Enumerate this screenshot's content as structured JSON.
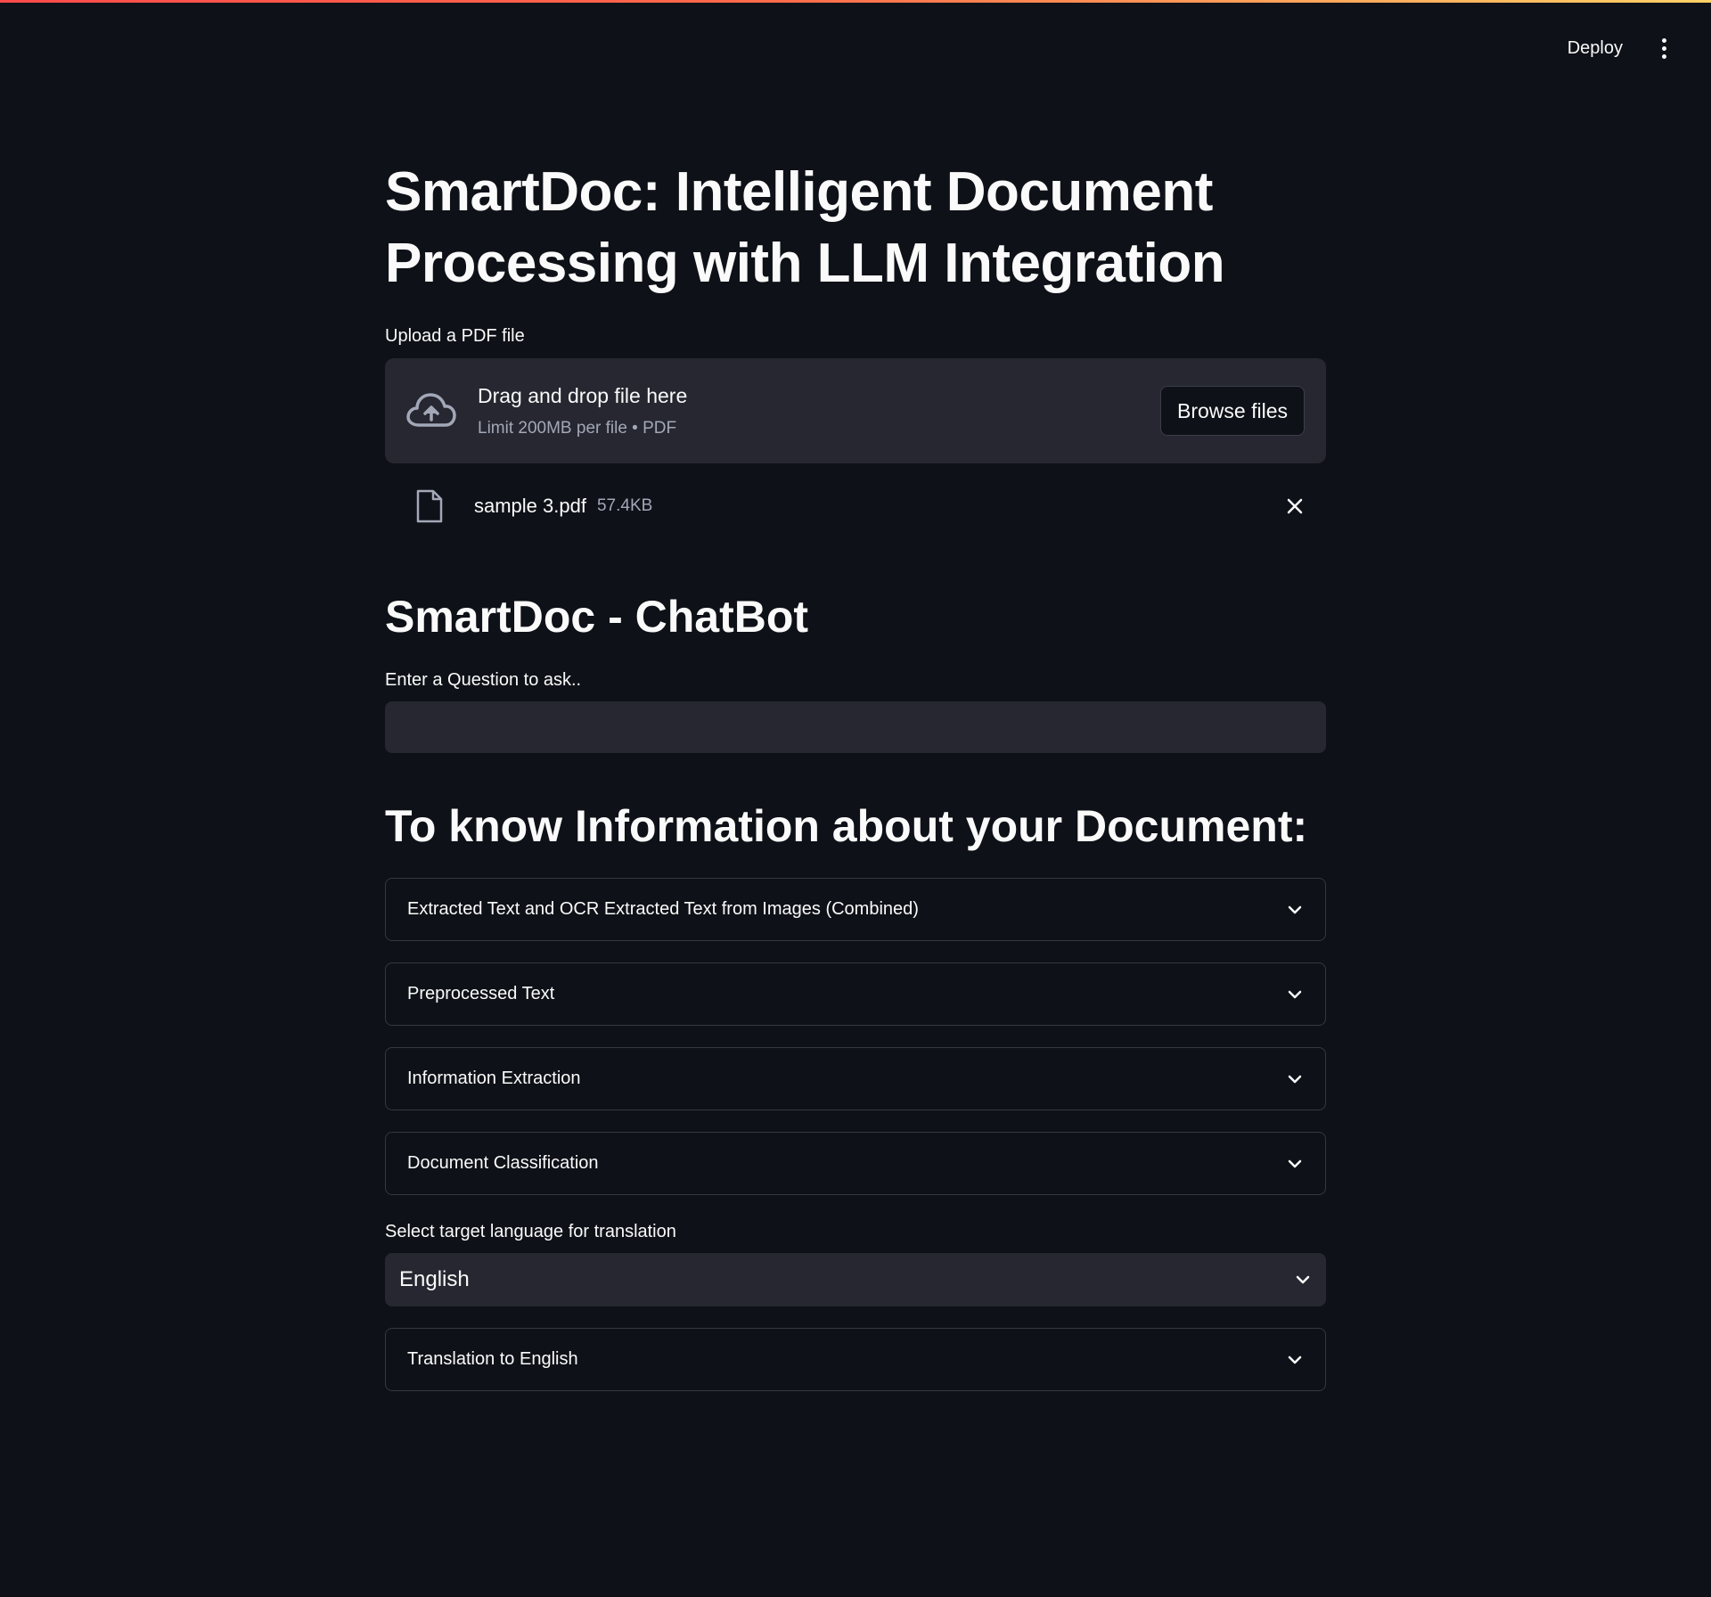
{
  "header": {
    "deploy_label": "Deploy",
    "menu_icon": "kebab-menu-icon"
  },
  "page": {
    "title": "SmartDoc: Intelligent Document Processing with LLM Integration"
  },
  "uploader": {
    "label": "Upload a PDF file",
    "drop_title": "Drag and drop file here",
    "limit_text": "Limit 200MB per file • PDF",
    "browse_label": "Browse files",
    "icon": "cloud-upload-icon"
  },
  "uploaded_file": {
    "name": "sample 3.pdf",
    "size": "57.4KB",
    "icon": "file-icon"
  },
  "chatbot": {
    "title": "SmartDoc - ChatBot",
    "question_label": "Enter a Question to ask..",
    "question_value": ""
  },
  "info": {
    "title": "To know Information about your Document:",
    "expanders": [
      {
        "label": "Extracted Text and OCR Extracted Text from Images (Combined)"
      },
      {
        "label": "Preprocessed Text"
      },
      {
        "label": "Information Extraction"
      },
      {
        "label": "Document Classification"
      }
    ]
  },
  "translation": {
    "select_label": "Select target language for translation",
    "selected_language": "English",
    "expander_label": "Translation to English"
  },
  "colors": {
    "background": "#0e1117",
    "widget_bg": "#262730",
    "text": "#fafafa",
    "muted_text": "#a3a8b8",
    "border": "#353843"
  }
}
